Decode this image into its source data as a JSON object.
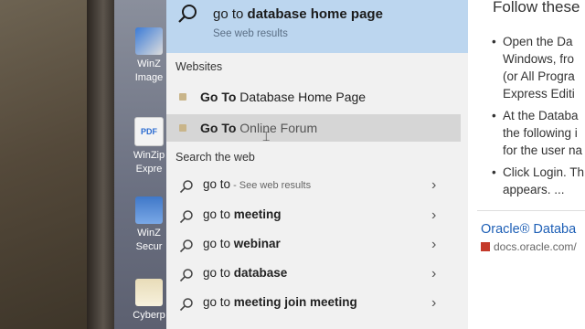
{
  "search": {
    "query_prefix": "go to ",
    "query_bold": "database home page",
    "see_web": "See web results"
  },
  "sections": {
    "websites": "Websites",
    "search_web": "Search the web"
  },
  "websites": [
    {
      "bold": "Go To",
      "rest": " Database Home Page"
    },
    {
      "bold": "Go To",
      "rest": " Online Forum"
    }
  ],
  "web_suggestions": [
    {
      "prefix": "go to",
      "bold": "",
      "dim": " - See web results"
    },
    {
      "prefix": "go to ",
      "bold": "meeting",
      "dim": ""
    },
    {
      "prefix": "go to ",
      "bold": "webinar",
      "dim": ""
    },
    {
      "prefix": "go to ",
      "bold": "database",
      "dim": ""
    },
    {
      "prefix": "go to ",
      "bold": "meeting join meeting",
      "dim": ""
    }
  ],
  "desktop_icons": [
    {
      "label": "WinZ\nImage"
    },
    {
      "label": "WinZip\nExpre"
    },
    {
      "label": "WinZ\nSecur"
    },
    {
      "label": "Cyberp"
    }
  ],
  "preview": {
    "title": "Follow these",
    "bullets": [
      [
        "Open the Da",
        "Windows, fro",
        "(or All Progra",
        "Express Editi"
      ],
      [
        "At the Databa",
        "the following i",
        "for the user na"
      ],
      [
        "Click Login. Th",
        "appears. ..."
      ]
    ],
    "link": "Oracle® Databa",
    "source": "docs.oracle.com/"
  },
  "chevron": "›",
  "colors": {
    "searchbar": "#bcd6ef",
    "panel": "#f1f1f1",
    "highlight": "#d6d6d6",
    "link": "#1d5fb6"
  }
}
